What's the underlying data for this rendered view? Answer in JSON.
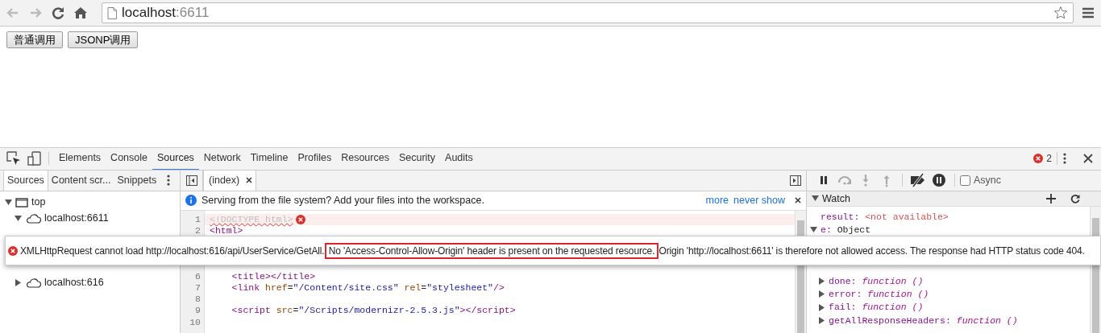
{
  "browser": {
    "url_host": "localhost",
    "url_port": ":6611"
  },
  "page": {
    "buttons": [
      "普通调用",
      "JSONP调用"
    ]
  },
  "devtools": {
    "tabs": [
      {
        "label": "Elements",
        "selected": false
      },
      {
        "label": "Console",
        "selected": false
      },
      {
        "label": "Sources",
        "selected": true
      },
      {
        "label": "Network",
        "selected": false
      },
      {
        "label": "Timeline",
        "selected": false
      },
      {
        "label": "Profiles",
        "selected": false
      },
      {
        "label": "Resources",
        "selected": false
      },
      {
        "label": "Security",
        "selected": false
      },
      {
        "label": "Audits",
        "selected": false
      }
    ],
    "error_count": "2",
    "navigator": {
      "tabs": [
        {
          "label": "Sources",
          "selected": true
        },
        {
          "label": "Content scr...",
          "selected": false
        },
        {
          "label": "Snippets",
          "selected": false
        }
      ],
      "tree": [
        {
          "label": "top",
          "kind": "frame",
          "expanded": true,
          "children": [
            {
              "label": "localhost:6611",
              "kind": "host",
              "expanded": true
            },
            {
              "label": "localhost:616",
              "kind": "host",
              "expanded": false
            }
          ]
        }
      ]
    },
    "editor": {
      "tabs": [
        {
          "label": "(index)",
          "selected": true
        }
      ],
      "infobar": {
        "message": "Serving from the file system? Add your files into the workspace.",
        "links": [
          "more",
          "never show"
        ]
      },
      "lines": [
        {
          "number": "1",
          "error": true,
          "tokens": [
            {
              "kind": "doctype",
              "text": "<!DOCTYPE html>"
            }
          ]
        },
        {
          "number": "2",
          "error": false,
          "tokens": [
            {
              "kind": "tag",
              "text": "<html>"
            }
          ]
        },
        {
          "number": "6",
          "error": false,
          "indented": true,
          "tokens": [
            {
              "kind": "tag",
              "text": "<title></title>"
            }
          ]
        },
        {
          "number": "7",
          "error": false,
          "indented": true,
          "tokens": [
            {
              "kind": "tag",
              "text": "<link "
            },
            {
              "kind": "attr",
              "text": "href"
            },
            {
              "kind": "plain",
              "text": "="
            },
            {
              "kind": "value",
              "text": "\"/Content/site.css\""
            },
            {
              "kind": "attr",
              "text": " rel"
            },
            {
              "kind": "plain",
              "text": "="
            },
            {
              "kind": "value",
              "text": "\"stylesheet\""
            },
            {
              "kind": "tag",
              "text": "/>"
            }
          ]
        },
        {
          "number": "8",
          "error": false
        },
        {
          "number": "9",
          "error": false,
          "indented": true,
          "tokens": [
            {
              "kind": "tag",
              "text": "<script "
            },
            {
              "kind": "attr",
              "text": "src"
            },
            {
              "kind": "plain",
              "text": "="
            },
            {
              "kind": "value",
              "text": "\"/Scripts/modernizr-2.5.3.js\""
            },
            {
              "kind": "tag",
              "text": "></script>"
            }
          ]
        },
        {
          "number": "10",
          "error": false
        }
      ]
    },
    "debugger": {
      "async": {
        "label": "Async",
        "checked": false
      },
      "watch": {
        "title": "Watch",
        "expanded": true,
        "items": [
          {
            "name": "result:",
            "value": "<not available>",
            "kind": "unavailable"
          },
          {
            "name": "e:",
            "value": "Object",
            "kind": "object",
            "expanded": true,
            "children": [
              {
                "name": "done:",
                "value": "function ()",
                "kind": "function",
                "expanded": false
              },
              {
                "name": "error:",
                "value": "function ()",
                "kind": "function",
                "expanded": false
              },
              {
                "name": "fail:",
                "value": "function ()",
                "kind": "function",
                "expanded": false
              },
              {
                "name": "getAllResponseHeaders:",
                "value": "function ()",
                "kind": "function",
                "expanded": false
              }
            ]
          }
        ]
      }
    },
    "error_popup": {
      "before": "XMLHttpRequest cannot load http://localhost:616/api/UserService/GetAll.",
      "highlighted": "No 'Access-Control-Allow-Origin' header is present on the requested resource.",
      "after": "Origin 'http://localhost:6611' is therefore not allowed access. The response had HTTP status code 404."
    }
  }
}
